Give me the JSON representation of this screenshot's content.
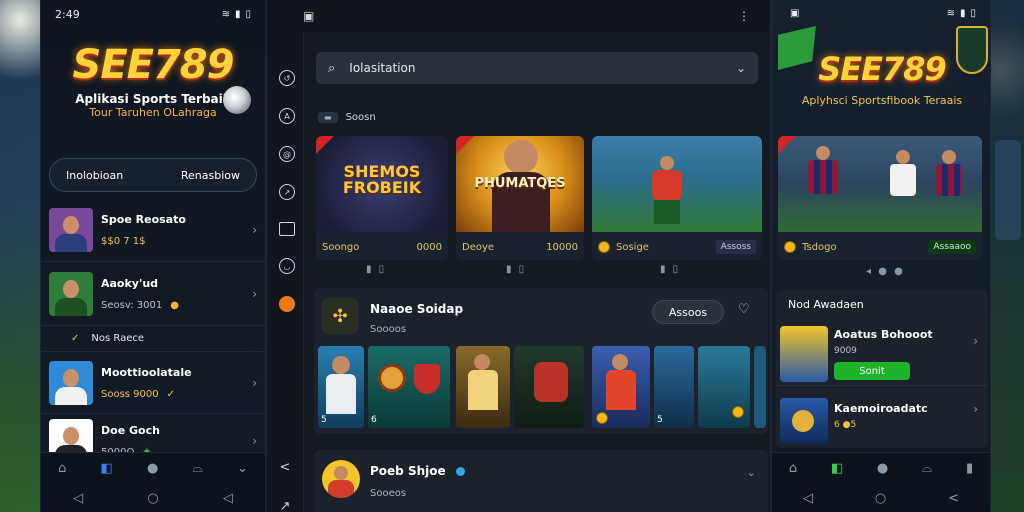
{
  "left_phone": {
    "time": "2:49",
    "status_icons": [
      "wifi-icon",
      "signal-icon",
      "battery-icon"
    ],
    "brand": "SEE789",
    "tagline_1": "Aplikasi Sports Terbaik",
    "tagline_2": "Tour Taruhen OLahraga",
    "login_label": "Inolobioan",
    "register_label": "Renasbiow",
    "list": [
      {
        "title": "Spoe Reosato",
        "meta": "$$0 7 1$",
        "badge": "★"
      },
      {
        "title": "Aaoky'ud",
        "meta": "Seosv: 3001",
        "badge": "●"
      },
      {
        "title": "Nos Raece",
        "meta": "",
        "badge": ""
      },
      {
        "title": "Moottioolatale",
        "meta": "Sooss 9000",
        "badge": "✓"
      },
      {
        "title": "Doe Goch",
        "meta": "5000O",
        "badge": "★"
      }
    ],
    "nav": [
      "home-icon",
      "bookmark-icon",
      "ball-icon",
      "bell-icon",
      "more-icon"
    ]
  },
  "middle_phone": {
    "search_placeholder": "Iolasitation",
    "section_label": "Soosn",
    "cards": [
      {
        "art_title": "SHEMOS FROBEIK",
        "left": "Soongo",
        "right": "0000",
        "art_color": "#2b2d5a"
      },
      {
        "art_title": "PHUMATQES",
        "left": "Deoye",
        "right": "10000",
        "art_color": "#d99a1f"
      },
      {
        "art_title": "",
        "left": "Sosige",
        "right": "Assoss",
        "art_color": "#2c6d8d"
      }
    ],
    "pager_1": "▮ ▯",
    "pager_2": "▮ ▯",
    "pager_3": "▮ ▯",
    "feature": {
      "title": "Naaoe Soidap",
      "subtitle": "Soooos",
      "action": "Assoos"
    },
    "tiles_left": [
      "5",
      "6"
    ],
    "tiles_right": [
      "5"
    ],
    "bottom_item": {
      "title": "Poeb Shjoe",
      "subtitle": "Sooeos"
    }
  },
  "right_phone": {
    "brand": "SEE789",
    "tagline": "Aplyhsci Sportsfibook Teraais",
    "card": {
      "left": "Tsdogo",
      "right": "Assaaoo"
    },
    "section_title": "Nod Awadaen",
    "rows": [
      {
        "title": "Aoatus Bohooot",
        "meta": "9009",
        "button": "Sonit"
      },
      {
        "title": "Kaemoiroadatc",
        "meta": "6 ●5",
        "button": ""
      }
    ],
    "nav": [
      "home-icon",
      "chat-icon",
      "ball-icon",
      "trophy-icon",
      "shirt-icon"
    ]
  }
}
